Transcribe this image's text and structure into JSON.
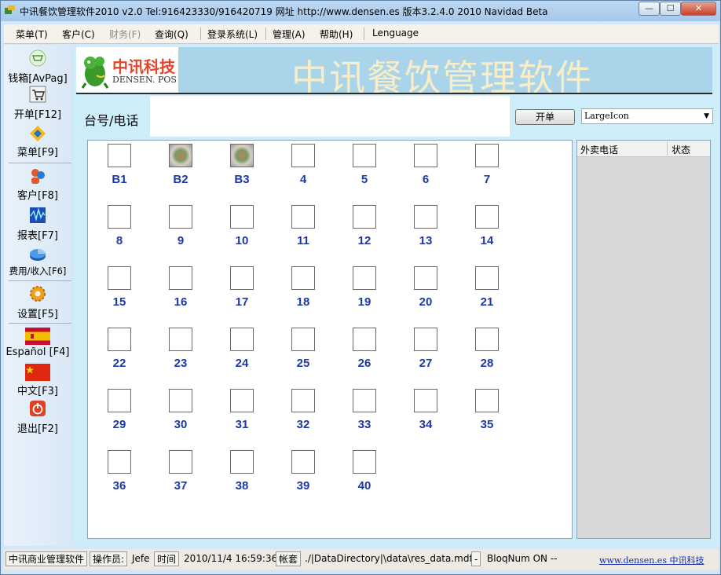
{
  "window": {
    "title": "中讯餐饮管理软件2010 v2.0 Tel:916423330/916420719 网址    http://www.densen.es   版本3.2.4.0  2010 Navidad Beta",
    "minimize": "—",
    "maximize": "☐",
    "close": "✕"
  },
  "menu": [
    {
      "label": "菜单(T)",
      "enabled": true
    },
    {
      "label": "客户(C)",
      "enabled": true
    },
    {
      "label": "财务(F)",
      "enabled": false
    },
    {
      "label": "查询(Q)",
      "enabled": true
    },
    {
      "label": "登录系统(L)",
      "enabled": true
    },
    {
      "label": "管理(A)",
      "enabled": true
    },
    {
      "label": "帮助(H)",
      "enabled": true
    },
    {
      "label": "Lenguage",
      "enabled": true
    }
  ],
  "sidebar": [
    {
      "label": "钱箱[AvPag]",
      "icon": "cart-green-icon"
    },
    {
      "label": "开单[F12]",
      "icon": "shopping-cart-icon"
    },
    {
      "label": "菜单[F9]",
      "icon": "menu-diamond-icon"
    },
    {
      "label": "客户[F8]",
      "icon": "customers-icon"
    },
    {
      "label": "报表[F7]",
      "icon": "report-chart-icon"
    },
    {
      "label": "费用/收入[F6]",
      "icon": "expense-pie-icon"
    },
    {
      "label": "设置[F5]",
      "icon": "settings-gear-icon"
    },
    {
      "label": "Español [F4]",
      "icon": "spain-flag-icon"
    },
    {
      "label": "中文[F3]",
      "icon": "china-flag-icon"
    },
    {
      "label": "退出[F2]",
      "icon": "exit-power-icon"
    }
  ],
  "banner": {
    "logo_cn": "中讯科技",
    "logo_en": "DENSEN. POS",
    "title": "中讯餐饮管理软件"
  },
  "search": {
    "label": "台号/电话",
    "value": "",
    "open_button": "开单",
    "view_mode": "LargeIcon",
    "view_arrow": "▼"
  },
  "tables": [
    {
      "label": "B1",
      "occupied": false
    },
    {
      "label": "B2",
      "occupied": true
    },
    {
      "label": "B3",
      "occupied": true
    },
    {
      "label": "4",
      "occupied": false
    },
    {
      "label": "5",
      "occupied": false
    },
    {
      "label": "6",
      "occupied": false
    },
    {
      "label": "7",
      "occupied": false
    },
    {
      "label": "8",
      "occupied": false
    },
    {
      "label": "9",
      "occupied": false
    },
    {
      "label": "10",
      "occupied": false
    },
    {
      "label": "11",
      "occupied": false
    },
    {
      "label": "12",
      "occupied": false
    },
    {
      "label": "13",
      "occupied": false
    },
    {
      "label": "14",
      "occupied": false
    },
    {
      "label": "15",
      "occupied": false
    },
    {
      "label": "16",
      "occupied": false
    },
    {
      "label": "17",
      "occupied": false
    },
    {
      "label": "18",
      "occupied": false
    },
    {
      "label": "19",
      "occupied": false
    },
    {
      "label": "20",
      "occupied": false
    },
    {
      "label": "21",
      "occupied": false
    },
    {
      "label": "22",
      "occupied": false
    },
    {
      "label": "23",
      "occupied": false
    },
    {
      "label": "24",
      "occupied": false
    },
    {
      "label": "25",
      "occupied": false
    },
    {
      "label": "26",
      "occupied": false
    },
    {
      "label": "27",
      "occupied": false
    },
    {
      "label": "28",
      "occupied": false
    },
    {
      "label": "29",
      "occupied": false
    },
    {
      "label": "30",
      "occupied": false
    },
    {
      "label": "31",
      "occupied": false
    },
    {
      "label": "32",
      "occupied": false
    },
    {
      "label": "33",
      "occupied": false
    },
    {
      "label": "34",
      "occupied": false
    },
    {
      "label": "35",
      "occupied": false
    },
    {
      "label": "36",
      "occupied": false
    },
    {
      "label": "37",
      "occupied": false
    },
    {
      "label": "38",
      "occupied": false
    },
    {
      "label": "39",
      "occupied": false
    },
    {
      "label": "40",
      "occupied": false
    }
  ],
  "delivery": {
    "col_phone": "外卖电话",
    "col_status": "状态"
  },
  "status": {
    "company": "中讯商业管理软件",
    "operator_label": "操作员:",
    "operator": "Jefe",
    "time_label": "时间",
    "time": "2010/11/4 16:59:36",
    "account_label": "帐套",
    "db_path": "./|DataDirectory|\\data\\res_data.mdf",
    "dash": "-",
    "bloq": "BloqNum ON  --",
    "link": "www.densen.es 中讯科技"
  },
  "colors": {
    "table_number": "#1d38a8",
    "banner_bg": "#a9d4ea",
    "main_bg": "#cdeef8",
    "logo_red": "#e2452b"
  }
}
